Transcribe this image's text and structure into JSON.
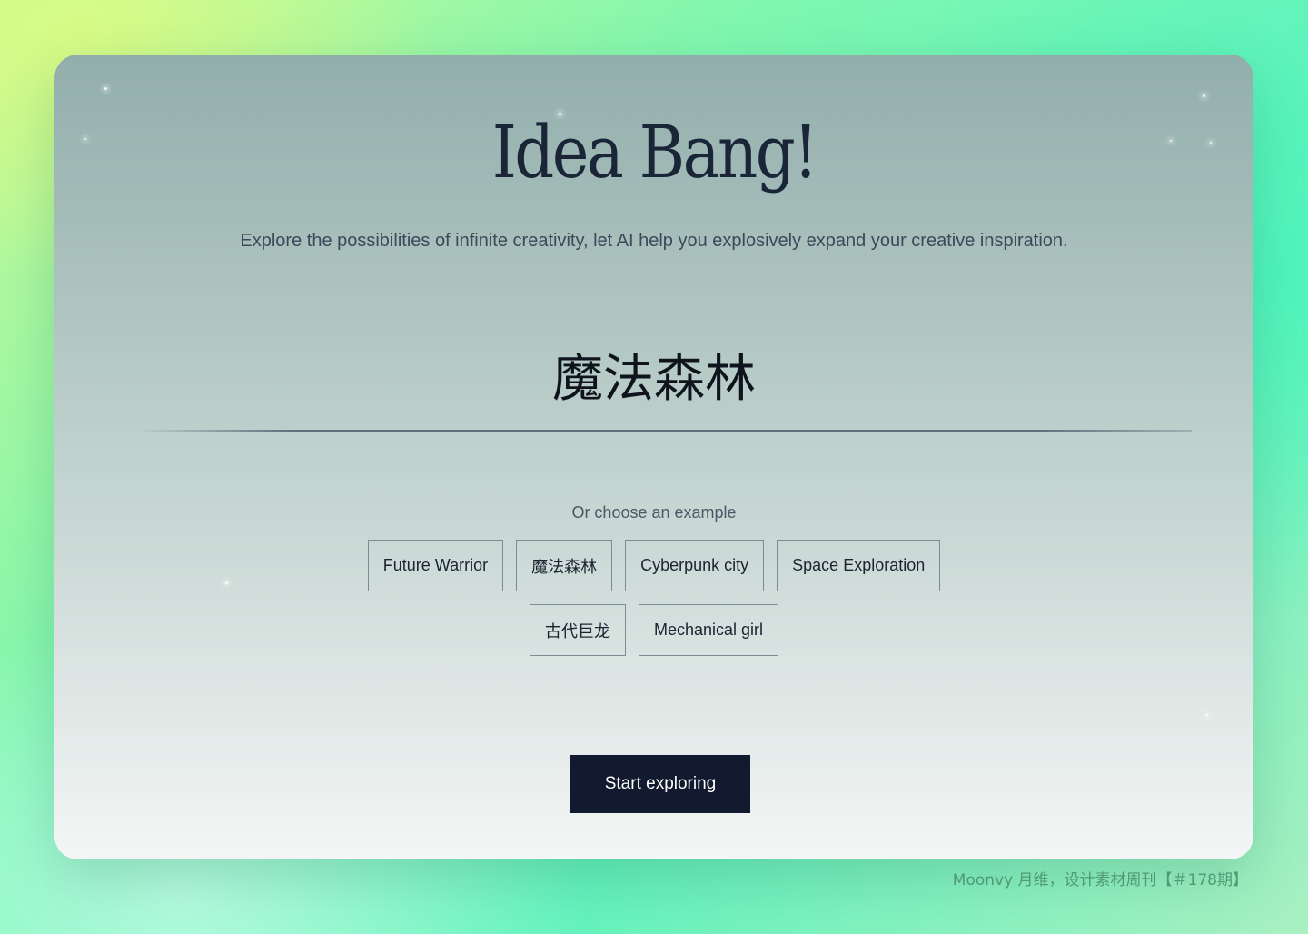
{
  "app": {
    "title": "Idea Bang!",
    "subtitle": "Explore the possibilities of infinite creativity, let AI help you explosively expand your creative inspiration."
  },
  "input": {
    "value": "魔法森林"
  },
  "examples": {
    "label": "Or choose an example",
    "items": [
      {
        "label": "Future Warrior"
      },
      {
        "label": "魔法森林"
      },
      {
        "label": "Cyberpunk city"
      },
      {
        "label": "Space Exploration"
      },
      {
        "label": "古代巨龙"
      },
      {
        "label": "Mechanical girl"
      }
    ]
  },
  "actions": {
    "start_label": "Start exploring"
  },
  "watermark": {
    "text": "Moonvy 月维，设计素材周刊【＃178期】"
  },
  "colors": {
    "button_bg": "#111a2e",
    "title_color": "#1a2638"
  }
}
